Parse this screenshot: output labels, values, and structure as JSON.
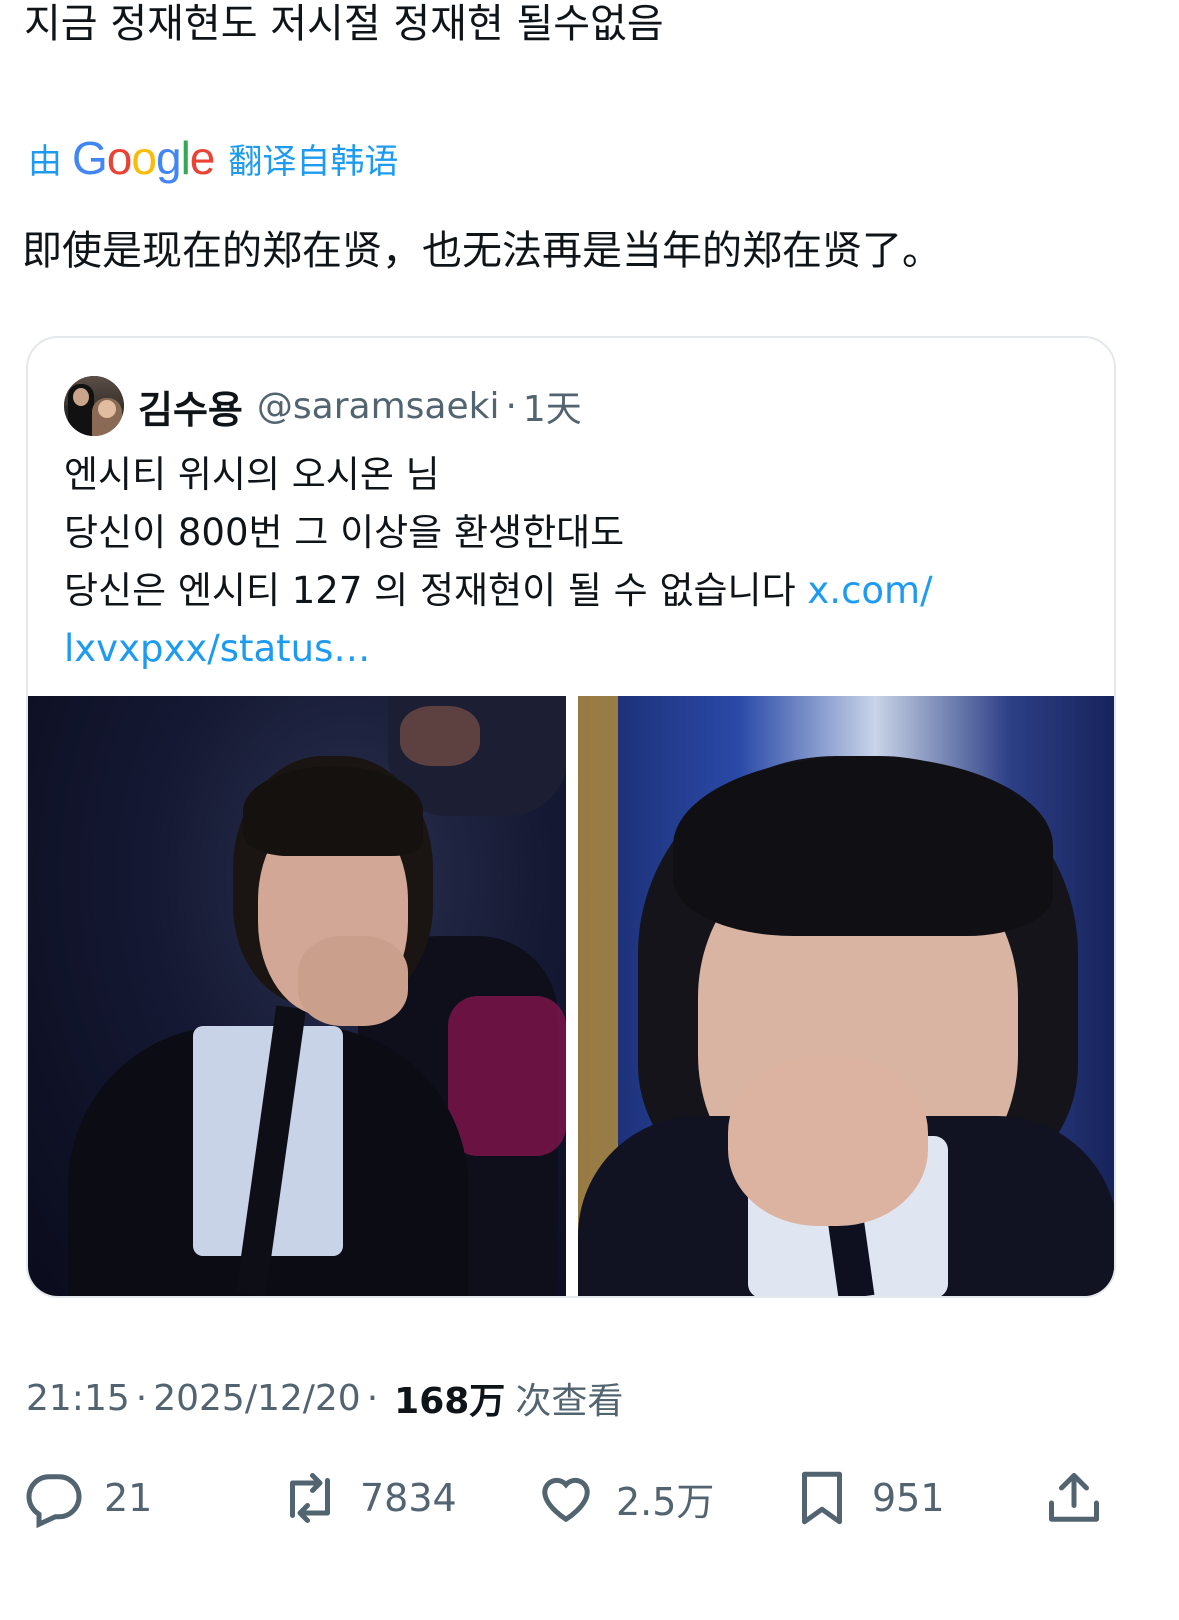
{
  "tweet": {
    "text_original": "지금 정재현도 저시절 정재현 될수없음",
    "translate_by": "由",
    "translate_label": "翻译自韩语",
    "text_translated": "即使是现在的郑在贤，也无法再是当年的郑在贤了。"
  },
  "google_logo": [
    "G",
    "o",
    "o",
    "g",
    "l",
    "e"
  ],
  "google_colors": [
    "#4285F4",
    "#EA4335",
    "#FBBC05",
    "#4285F4",
    "#34A853",
    "#EA4335"
  ],
  "quote": {
    "name": "김수용",
    "handle": "@saramsaeki",
    "separator": "·",
    "time": "1天",
    "lines": [
      "엔시티 위시의 오시온 님",
      "당신이 800번 그 이상을 환생한대도",
      "당신은 엔시티 127 의 정재현이 될 수 없습니다"
    ],
    "link_part1": "x.com/",
    "link_part2": "lxvxpxx/status…"
  },
  "meta": {
    "time": "21:15",
    "sep1": "·",
    "date": "2025/12/20",
    "sep2": "·",
    "views": "168万",
    "views_label": "次查看"
  },
  "actions": {
    "reply_count": "21",
    "retweet_count": "7834",
    "like_count": "2.5万",
    "bookmark_count": "951"
  },
  "icons": [
    "reply-icon",
    "retweet-icon",
    "like-icon",
    "bookmark-icon",
    "share-icon"
  ],
  "colors": {
    "link": "#1d9bf0",
    "secondary_text": "#536471",
    "primary_text": "#0f1419",
    "border": "#e5e8eb"
  }
}
